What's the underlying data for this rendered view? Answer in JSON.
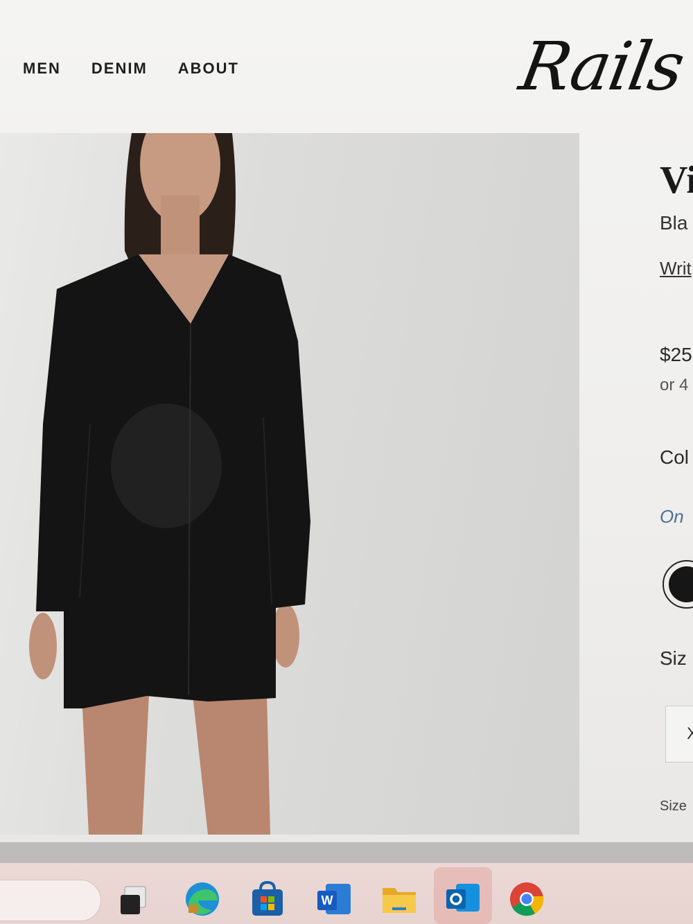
{
  "nav": {
    "items": [
      "MEN",
      "DENIM",
      "ABOUT"
    ]
  },
  "brand": {
    "logo_text": "Rails"
  },
  "product": {
    "title": "Vi",
    "color_name": "Bla",
    "review_link": "Writ",
    "price": "$25",
    "installments": "or 4",
    "color_label": "Col",
    "stock_note": "On",
    "swatch_color": "#161616",
    "size_label": "Siz",
    "size_option": "X",
    "size_guide": "Size"
  },
  "taskbar": {
    "icons": [
      "task-view-icon",
      "edge-icon",
      "store-icon",
      "word-icon",
      "file-explorer-icon",
      "outlook-icon",
      "chrome-icon"
    ]
  },
  "colors": {
    "dress": "#141414",
    "photo_bg": "#d8d8d6",
    "stock_text": "#4f6f95",
    "taskbar": "#e7d3d0"
  }
}
